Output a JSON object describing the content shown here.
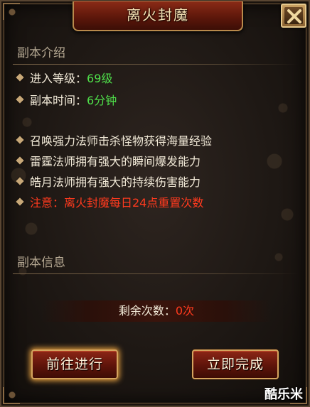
{
  "dialog": {
    "title": "离火封魔",
    "close_icon": "close-x-icon"
  },
  "intro": {
    "section_title": "副本介绍",
    "level_label": "进入等级：",
    "level_value": "69级",
    "time_label": "副本时间：",
    "time_value": "6分钟",
    "tips": [
      "召唤强力法师击杀怪物获得海量经验",
      "雷霆法师拥有强大的瞬间爆发能力",
      "皓月法师拥有强大的持续伤害能力"
    ],
    "notice": "注意：离火封魔每日24点重置次数"
  },
  "info": {
    "section_title": "副本信息",
    "remaining_label": "剩余次数：",
    "remaining_value": "0次"
  },
  "buttons": {
    "go": "前往进行",
    "finish": "立即完成"
  },
  "watermark": "酷乐米",
  "colors": {
    "highlight_green": "#4fe04a",
    "warning_red": "#ff3a1e",
    "title_bar": "#8a2a16",
    "gold_border": "#d4a45e"
  }
}
